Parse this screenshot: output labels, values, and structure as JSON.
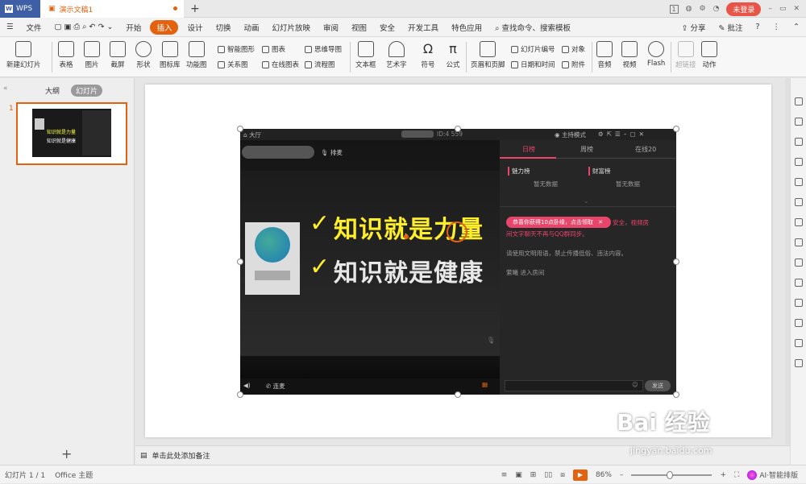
{
  "titlebar": {
    "app_name": "WPS",
    "doc_tab": "演示文稿1",
    "page_badge": "1",
    "login": "未登录"
  },
  "menu": {
    "file": "文件",
    "items": [
      "开始",
      "插入",
      "设计",
      "切换",
      "动画",
      "幻灯片放映",
      "审阅",
      "视图",
      "安全",
      "开发工具",
      "特色应用"
    ],
    "active": "插入",
    "search": "查找命令、搜索模板",
    "share": "分享",
    "comment": "批注"
  },
  "ribbon": {
    "big": [
      "新建幻灯片",
      "表格",
      "图片",
      "截屏",
      "形状",
      "图标库",
      "功能图",
      "文本框",
      "艺术字",
      "符号",
      "公式",
      "页眉和页脚",
      "音频",
      "视频",
      "Flash",
      "超链接",
      "动作"
    ],
    "small": [
      "智能图形",
      "图表",
      "思维导图",
      "关系图",
      "在线图表",
      "流程图",
      "幻灯片编号",
      "对象",
      "日期和时间",
      "附件"
    ]
  },
  "panel": {
    "outline_tab": "大纲",
    "slides_tab": "幻灯片",
    "slide_number": "1"
  },
  "notes": {
    "placeholder": "单击此处添加备注"
  },
  "status": {
    "slide_info": "幻灯片 1 / 1",
    "theme": "Office 主题",
    "zoom": "86%",
    "ai": "AI·智能排版"
  },
  "embedded": {
    "hall": "大厅",
    "room_id": "ID:4      559",
    "mode": "主持模式",
    "mic_label": "排麦",
    "line1": "知识就是力量",
    "line2": "知识就是健康",
    "tabs": [
      "日榜",
      "周榜",
      "在线20"
    ],
    "rank1": "魅力榜",
    "rank2": "财富榜",
    "empty1": "暂无数据",
    "empty2": "暂无数据",
    "badge": "恭喜你获得10点卧缘，点击领取",
    "msg1a": "安全，视频房",
    "msg1b": "间文字聊天不再与QQ群同步。",
    "msg2": "请使用文明用语，禁止传播低俗、违法内容。",
    "msg3": "萦曦 进入房间",
    "connect": "连麦",
    "send": "发送"
  },
  "watermark": {
    "brand": "Bai 经验",
    "url": "jingyan.baidu.com"
  }
}
